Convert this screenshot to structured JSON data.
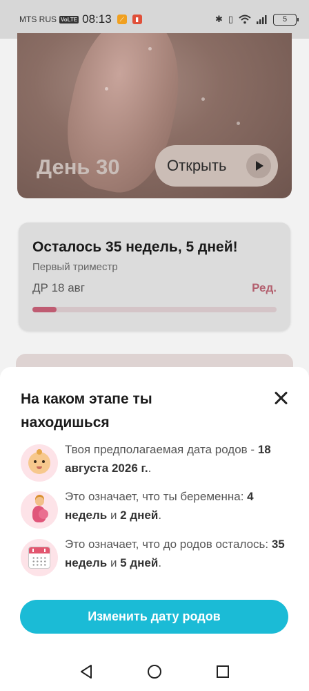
{
  "status_bar": {
    "carrier": "MTS RUS",
    "network_badge": "VoLTE",
    "time": "08:13",
    "battery": "5",
    "icons": [
      "app-icon-1",
      "app-icon-2",
      "bluetooth-icon",
      "vibrate-icon",
      "wifi-icon",
      "signal-icon",
      "battery-icon"
    ]
  },
  "hero": {
    "day_label": "День 30",
    "open_button_label": "Открыть"
  },
  "pregnancy_card": {
    "title": "Осталось 35 недель, 5 дней!",
    "trimester": "Первый триместр",
    "due_date_short": "ДР 18 авг",
    "edit_label": "Ред.",
    "progress": 0.1,
    "progress_color": "#bf5c72"
  },
  "sheet": {
    "title": "На каком этапе ты находишься",
    "rows": [
      {
        "icon": "baby-face-icon",
        "text_before": "Твоя предполагаемая дата родов - ",
        "bold_1": "18 августа 2026 г.",
        "text_mid": ".",
        "bold_2": "",
        "text_after": ""
      },
      {
        "icon": "pregnant-woman-icon",
        "text_before": "Это означает, что ты беременна: ",
        "bold_1": "4 недель",
        "text_mid": " и ",
        "bold_2": "2 дней",
        "text_after": "."
      },
      {
        "icon": "calendar-icon",
        "text_before": "Это означает, что до родов осталось: ",
        "bold_1": "35 недель",
        "text_mid": " и ",
        "bold_2": "5 дней",
        "text_after": "."
      }
    ],
    "button_label": "Изменить дату родов",
    "button_color": "#1bbbd6"
  },
  "nav_bar": {
    "icons": [
      "back-icon",
      "home-icon",
      "recents-icon"
    ]
  }
}
